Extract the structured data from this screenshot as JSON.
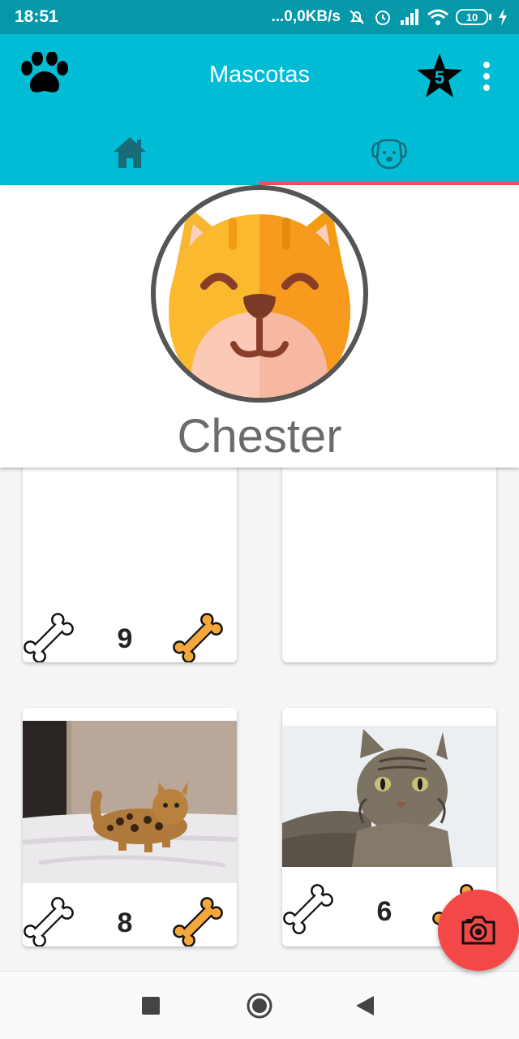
{
  "status_bar": {
    "time": "18:51",
    "network_speed": "...0,0KB/s",
    "battery_level": "10",
    "icons": [
      "mute-bell-icon",
      "alarm-icon",
      "signal-icon",
      "wifi-icon",
      "battery-icon",
      "charging-icon"
    ]
  },
  "app_bar": {
    "title": "Mascotas",
    "logo_icon": "paw-icon",
    "rating_badge": "5",
    "menu_icon": "more-vertical-icon",
    "background": "#00bcd4"
  },
  "tabs": [
    {
      "icon": "home-icon",
      "active": false
    },
    {
      "icon": "dog-face-icon",
      "active": true
    }
  ],
  "profile": {
    "name": "Chester",
    "avatar_icon": "cat-face-icon"
  },
  "grid": {
    "cards": [
      {
        "count": "9",
        "has_photo": false,
        "photo": ""
      },
      {
        "count": "",
        "has_photo": false,
        "photo": ""
      },
      {
        "count": "8",
        "has_photo": true,
        "photo": "bengal-kitten-photo"
      },
      {
        "count": "6",
        "has_photo": true,
        "photo": "tabby-cat-photo"
      }
    ],
    "icons": [
      "bone-outline-icon",
      "bone-filled-icon"
    ]
  },
  "fab": {
    "icon": "camera-icon",
    "color": "#f44848"
  },
  "nav_bar": {
    "buttons": [
      "recents-square-icon",
      "home-circle-icon",
      "back-triangle-icon"
    ]
  },
  "colors": {
    "status_bar": "#0598a8",
    "accent_indicator": "#ef5350",
    "bone_filled": "#f4a83c"
  }
}
